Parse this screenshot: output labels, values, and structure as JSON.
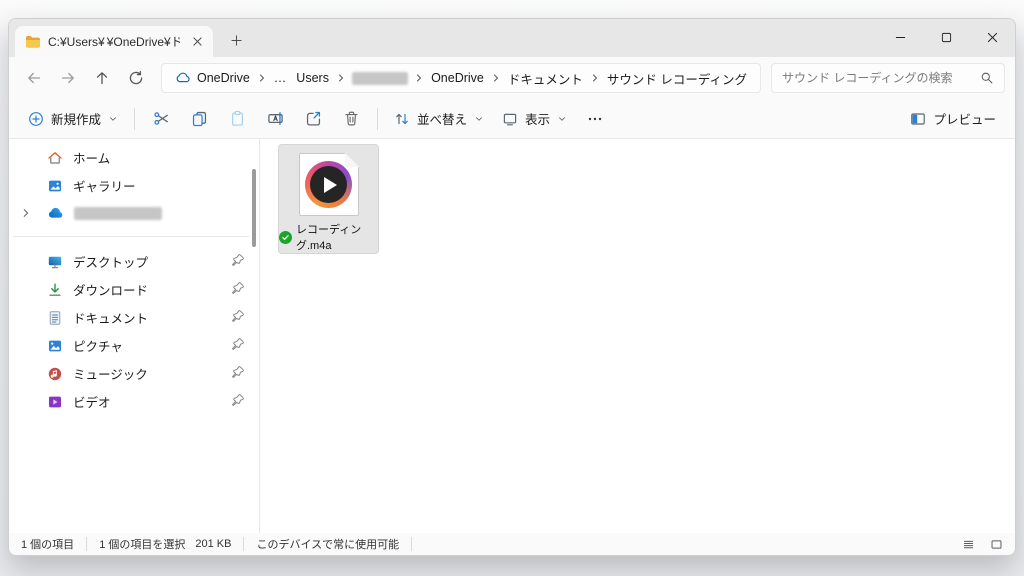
{
  "window": {
    "tab": {
      "title_prefix": "C:¥Users¥",
      "title_suffix": "¥OneDrive¥ドキュ"
    }
  },
  "nav": {
    "breadcrumb": [
      {
        "label": "OneDrive",
        "icon": "onedrive-cloud-icon"
      },
      {
        "label": "…"
      },
      {
        "label": "Users"
      },
      {
        "label": "",
        "redacted": true
      },
      {
        "label": "OneDrive"
      },
      {
        "label": "ドキュメント"
      },
      {
        "label": "サウンド レコーディング"
      }
    ],
    "search_placeholder": "サウンド レコーディングの検索"
  },
  "toolbar": {
    "new_label": "新規作成",
    "sort_label": "並べ替え",
    "view_label": "表示",
    "preview_label": "プレビュー"
  },
  "sidebar": {
    "top_items": [
      {
        "label": "ホーム",
        "icon": "home-icon"
      },
      {
        "label": "ギャラリー",
        "icon": "gallery-icon"
      },
      {
        "label": "",
        "icon": "onedrive-icon",
        "redacted": true,
        "expandable": true
      }
    ],
    "pinned_items": [
      {
        "label": "デスクトップ",
        "icon": "desktop-icon",
        "pinned": true
      },
      {
        "label": "ダウンロード",
        "icon": "download-icon",
        "pinned": true
      },
      {
        "label": "ドキュメント",
        "icon": "document-icon",
        "pinned": true
      },
      {
        "label": "ピクチャ",
        "icon": "pictures-icon",
        "pinned": true
      },
      {
        "label": "ミュージック",
        "icon": "music-icon",
        "pinned": true
      },
      {
        "label": "ビデオ",
        "icon": "video-icon",
        "pinned": true
      }
    ]
  },
  "content": {
    "file": {
      "name": "レコーディング.m4a",
      "sync_status": "available-on-device",
      "selected": true
    }
  },
  "statusbar": {
    "item_count": "1 個の項目",
    "selection": "1 個の項目を選択",
    "selection_size": "201 KB",
    "availability": "このデバイスで常に使用可能"
  },
  "colors": {
    "accent_blue": "#2f7fd6",
    "check_green": "#1ba629",
    "folder_yellow": "#f6c84c",
    "titlebar_gray": "#e7e7e7"
  }
}
